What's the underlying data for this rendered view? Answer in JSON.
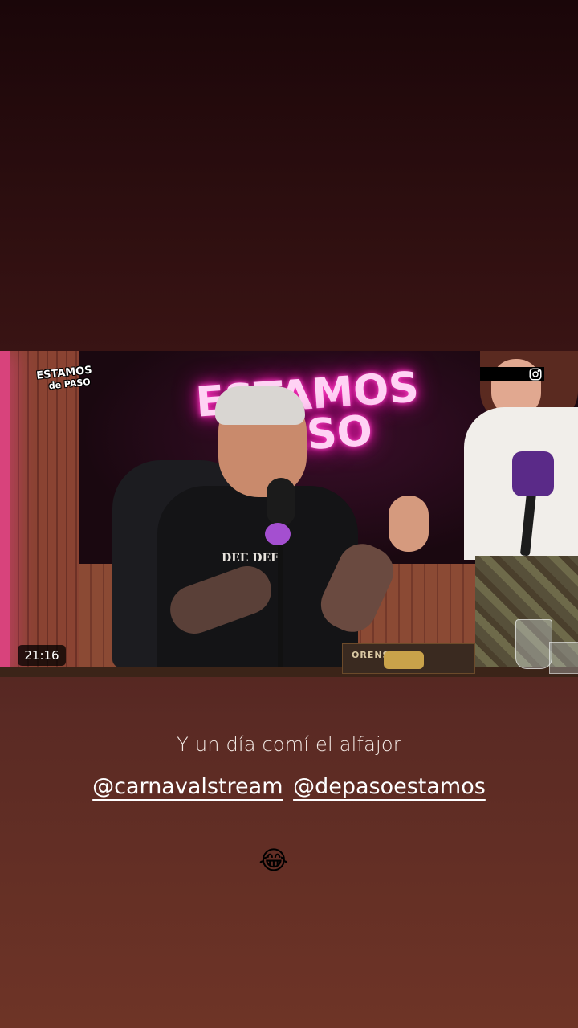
{
  "video": {
    "logo_line1": "ESTAMOS",
    "logo_line2": "de PASO",
    "neon_line1": "ESTAMOS",
    "neon_line2": "PASO",
    "shirt_text": "DEE DEE",
    "snack_label": "ORENSE",
    "timestamp": "21:16",
    "corner_icon": "instagram-icon"
  },
  "story": {
    "caption": "Y un día comí el alfajor",
    "mentions": [
      "@carnavalstream",
      "@depasoestamos"
    ],
    "emoji": "😂"
  }
}
